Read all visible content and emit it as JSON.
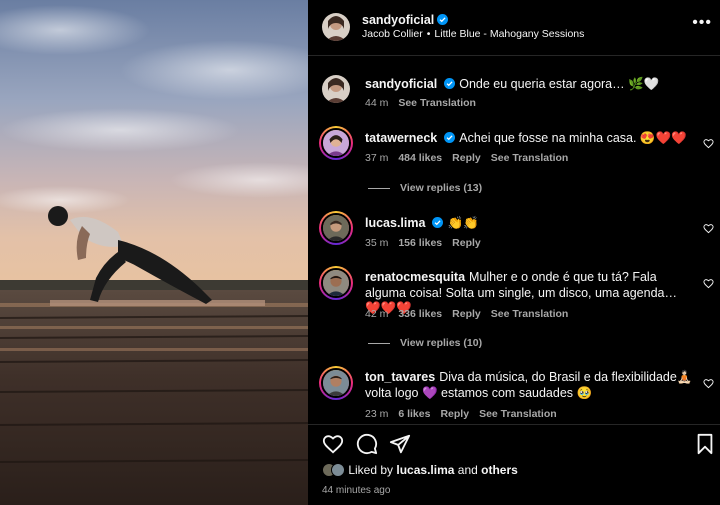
{
  "header": {
    "username": "sandyoficial",
    "artist": "Jacob Collier",
    "track": "Little Blue - Mahogany Sessions",
    "more_label": "•••"
  },
  "caption": {
    "username": "sandyoficial",
    "text": "Onde eu queria estar agora… 🌿🤍",
    "time": "44 m",
    "translate": "See Translation"
  },
  "comments": [
    {
      "username": "tatawerneck",
      "verified": true,
      "text": "Achei que fosse na minha casa. 😍❤️❤️",
      "time": "37 m",
      "likes": "484 likes",
      "reply": "Reply",
      "translate": "See Translation",
      "view_replies": "View replies (13)"
    },
    {
      "username": "lucas.lima",
      "verified": true,
      "text": "👏👏",
      "time": "35 m",
      "likes": "156 likes",
      "reply": "Reply"
    },
    {
      "username": "renatocmesquita",
      "verified": false,
      "text": "Mulher e o onde é que tu tá? Fala alguma coisa! Solta um single, um disco, uma agenda… ❤️❤️❤️",
      "time": "42 m",
      "likes": "336 likes",
      "reply": "Reply",
      "translate": "See Translation",
      "view_replies": "View replies (10)"
    },
    {
      "username": "ton_tavares",
      "verified": false,
      "text": "Diva da música, do Brasil e da flexibilidade🧘🏻 volta logo 💜 estamos com saudades 🥹",
      "time": "23 m",
      "likes": "6 likes",
      "reply": "Reply",
      "translate": "See Translation"
    }
  ],
  "footer": {
    "liked_by_prefix": "Liked by",
    "liked_by_user": "lucas.lima",
    "liked_by_and": "and",
    "liked_by_others": "others",
    "time_ago": "44 minutes ago"
  },
  "icons": {
    "verified": "verified-badge-icon",
    "like": "heart-icon",
    "comment": "comment-bubble-icon",
    "share": "paper-plane-icon",
    "save": "bookmark-icon",
    "more": "more-options-icon"
  },
  "colors": {
    "background": "#000000",
    "text": "#f5f5f5",
    "secondary_text": "#a8a8a8",
    "verified_blue": "#0095f6",
    "divider": "#262626"
  }
}
